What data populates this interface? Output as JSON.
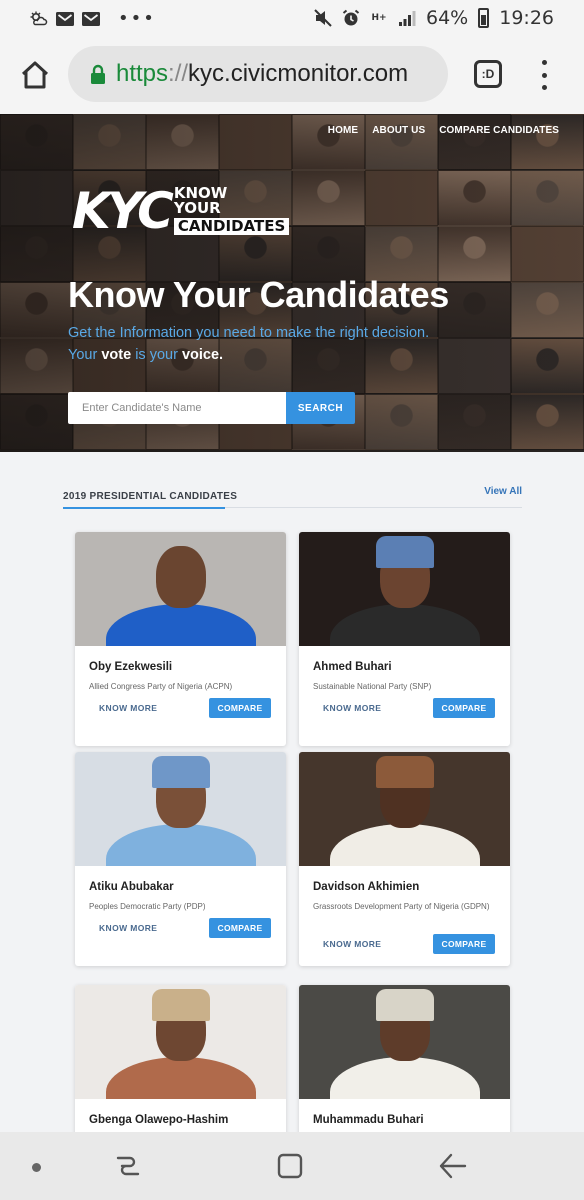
{
  "status_bar": {
    "battery": "64%",
    "time": "19:26",
    "left_icons": [
      "weather-icon",
      "gmail-icon",
      "gmail-icon",
      "more-dots-icon"
    ],
    "right_icons": [
      "mute-icon",
      "alarm-icon",
      "data-hplus-icon",
      "signal-icon",
      "battery-icon"
    ],
    "network": "H+"
  },
  "browser": {
    "url_scheme": "https",
    "url_sep": "://",
    "url_host": "kyc.civicmonitor.com",
    "tab_label": ":D"
  },
  "hero": {
    "nav": [
      "HOME",
      "ABOUT US",
      "COMPARE CANDIDATES"
    ],
    "logo_mark": "KYC",
    "logo_words": [
      "KNOW",
      "YOUR",
      "CANDIDATES"
    ],
    "title": "Know Your Candidates",
    "subtitle_line1": "Get the Information you need to make the right decision.",
    "subtitle_your": "Your",
    "subtitle_vote": "vote",
    "subtitle_is_your": "is your",
    "subtitle_voice": "voice.",
    "search_placeholder": "Enter Candidate's Name",
    "search_button": "SEARCH"
  },
  "section": {
    "title": "2019 PRESIDENTIAL CANDIDATES",
    "view_all": "View All"
  },
  "candidate_actions": {
    "know_more": "KNOW MORE",
    "compare": "COMPARE"
  },
  "candidates": [
    {
      "name": "Oby Ezekwesili",
      "party": "Allied Congress Party of Nigeria (ACPN)",
      "bg": "#b9b6b3",
      "skin": "#6a4530",
      "outfit": "#1f5fc7",
      "cap": ""
    },
    {
      "name": "Ahmed Buhari",
      "party": "Sustainable National Party (SNP)",
      "bg": "#241c1a",
      "skin": "#6b4430",
      "outfit": "#2a2a2a",
      "cap": "#5b7fb4"
    },
    {
      "name": "Atiku Abubakar",
      "party": "Peoples Democratic Party (PDP)",
      "bg": "#d7dde4",
      "skin": "#7a5038",
      "outfit": "#7fb1de",
      "cap": "#6f97c8"
    },
    {
      "name": "Davidson Akhimien",
      "party": "Grassroots Development Party of Nigeria (GDPN)",
      "bg": "#45362c",
      "skin": "#4f3122",
      "outfit": "#f0ede6",
      "cap": "#8c5a3a"
    },
    {
      "name": "Gbenga Olawepo-Hashim",
      "party": "",
      "bg": "#ece9e6",
      "skin": "#6e4732",
      "outfit": "#b06a4b",
      "cap": "#c9b08a"
    },
    {
      "name": "Muhammadu Buhari",
      "party": "",
      "bg": "#4b4a46",
      "skin": "#5e3c2a",
      "outfit": "#f1efe9",
      "cap": "#d8d4c8"
    }
  ],
  "nav_bar": [
    "recents-icon",
    "home-square-icon",
    "back-arrow-icon"
  ]
}
